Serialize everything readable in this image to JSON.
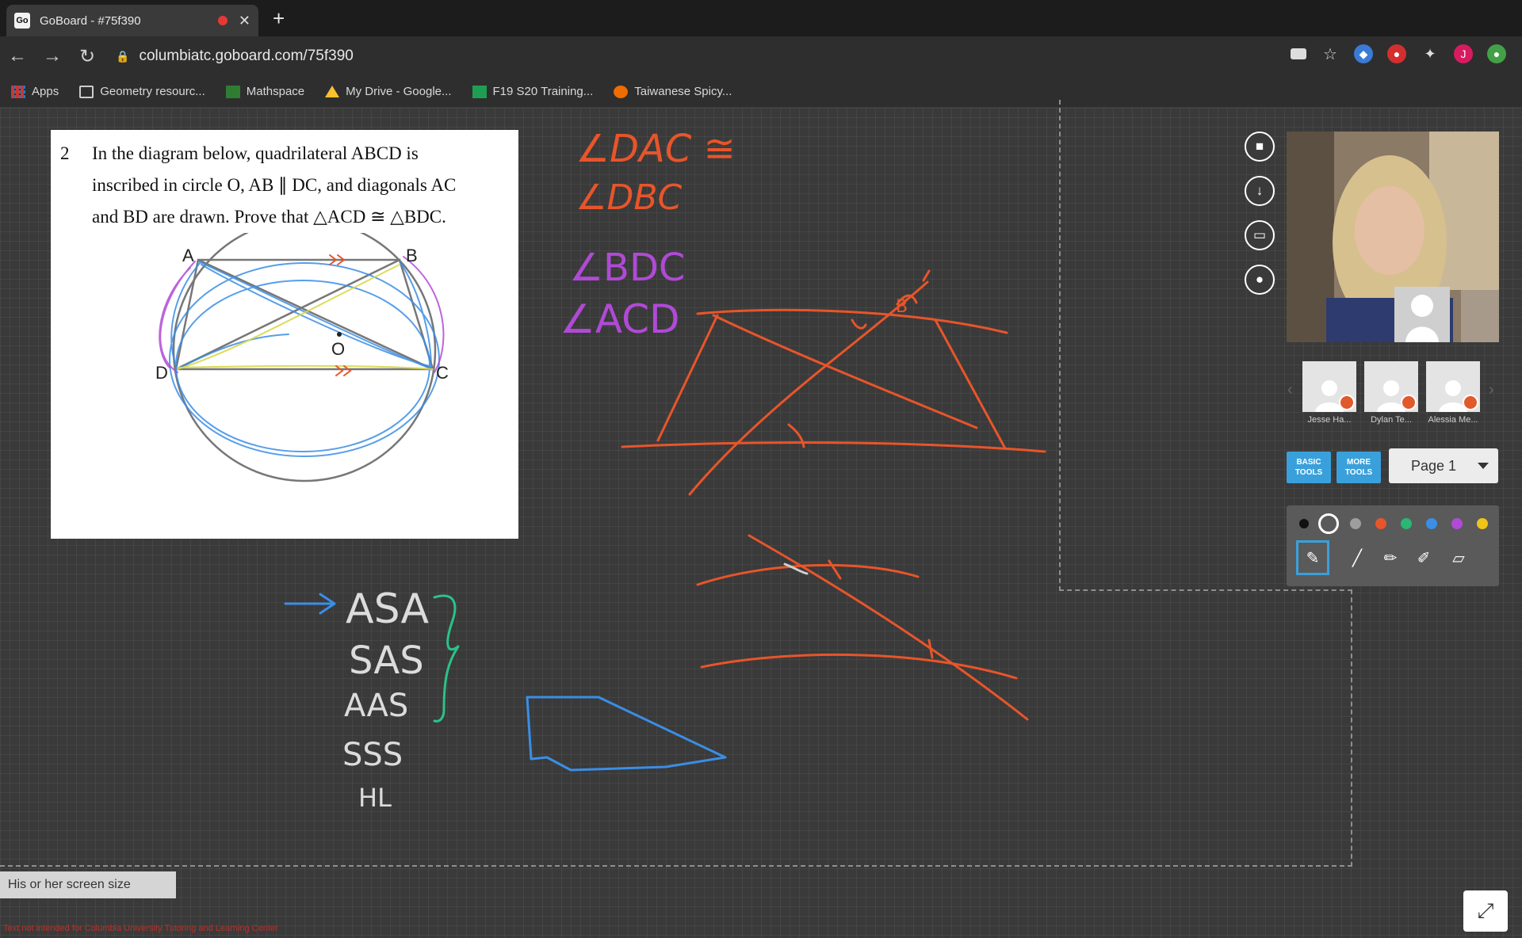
{
  "browser": {
    "tab_title": "GoBoard - #75f390",
    "tab_favicon": "Go",
    "url": "columbiatc.goboard.com/75f390",
    "bookmarks": [
      {
        "label": "Apps",
        "icon": "apps-grid-icon"
      },
      {
        "label": "Geometry resourc...",
        "icon": "folder-icon"
      },
      {
        "label": "Mathspace",
        "icon": "mathspace-icon"
      },
      {
        "label": "My Drive - Google...",
        "icon": "google-drive-icon"
      },
      {
        "label": "F19 S20 Training...",
        "icon": "sheets-icon"
      },
      {
        "label": "Taiwanese Spicy...",
        "icon": "food-icon"
      }
    ]
  },
  "problem": {
    "number": "2",
    "lines": [
      "In the diagram below, quadrilateral ABCD is",
      "inscribed in circle O, AB ∥ DC, and diagonals AC",
      "and BD are drawn. Prove that △ACD ≅ △BDC."
    ],
    "points": {
      "A": "A",
      "B": "B",
      "C": "C",
      "D": "D",
      "O": "O"
    }
  },
  "board_text": {
    "angle1": "∠DAC ≅",
    "angle2": "∠DBC",
    "angle3": "∠BDC",
    "angle4": "∠ACD",
    "criteria": [
      "ASA",
      "SAS",
      "AAS",
      "SSS",
      "HL"
    ],
    "label_b": "B"
  },
  "session": {
    "participants": [
      {
        "name": "Jesse Ha..."
      },
      {
        "name": "Dylan Te..."
      },
      {
        "name": "Alessia Me..."
      }
    ],
    "basic_tools_label": "BASIC TOOLS",
    "more_tools_label": "MORE TOOLS",
    "page_label": "Page 1",
    "palette_colors": [
      "#111111",
      "#ffffff",
      "#9e9e9e",
      "#e8552a",
      "#2bb673",
      "#3a8ee6",
      "#b04ad6",
      "#f0c419"
    ],
    "screen_size_label": "His or her screen size",
    "footer_note": "Text not intended for Columbia University Tutoring and Learning Center"
  },
  "ink_colors": {
    "orange": "#e8552a",
    "purple": "#b04ad6",
    "blue": "#3a8ee6",
    "teal": "#2bc28a",
    "white": "#dcdcdc"
  }
}
